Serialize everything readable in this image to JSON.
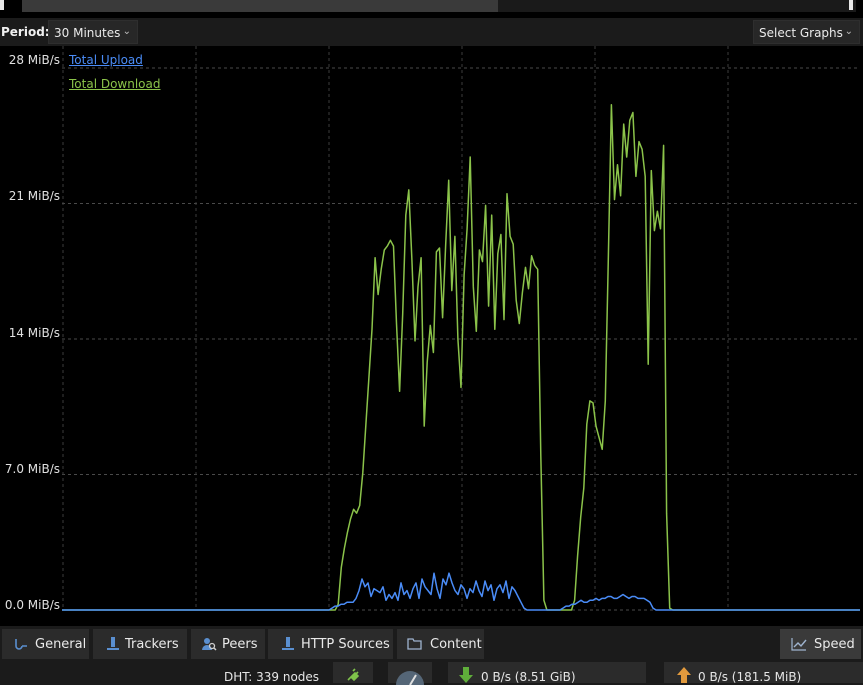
{
  "period": {
    "label": "Period:",
    "value": "30 Minutes"
  },
  "graphs_button": {
    "label": "Select Graphs"
  },
  "y_axis": {
    "ticks": [
      "28 MiB/s",
      "21 MiB/s",
      "14 MiB/s",
      "7.0 MiB/s",
      "0.0 MiB/s"
    ]
  },
  "legend": {
    "upload": {
      "label": "Total Upload",
      "color": "#4a8cf7"
    },
    "download": {
      "label": "Total Download",
      "color": "#8bc34a"
    }
  },
  "chart_data": {
    "type": "line",
    "ylim": [
      0,
      28
    ],
    "grid": true,
    "legend_placement": "top-left",
    "series": [
      {
        "name": "Total Download",
        "color": "#8bc34a",
        "values": [
          0,
          0,
          0,
          0,
          0,
          0,
          0,
          0,
          0,
          0,
          0,
          0,
          0,
          0,
          0,
          0,
          0,
          0,
          0,
          0,
          0,
          0,
          0,
          0,
          0,
          0,
          0,
          0,
          0,
          0,
          0,
          0,
          0,
          0,
          0,
          0,
          0,
          0,
          0,
          0,
          0,
          0,
          0,
          0,
          0,
          0,
          0,
          0,
          0,
          0,
          0,
          0,
          0,
          0,
          0,
          0,
          0,
          0,
          0,
          0,
          0,
          0,
          0,
          0,
          0,
          0,
          0,
          0,
          0,
          0,
          0,
          0,
          0,
          0,
          0,
          0,
          0,
          0,
          0,
          0,
          0,
          0,
          0,
          0,
          0,
          0,
          0,
          0,
          0,
          0,
          0.3,
          2.2,
          3.2,
          4.0,
          4.7,
          5.2,
          5.0,
          5.4,
          7.1,
          9.6,
          12.0,
          14.5,
          18.2,
          16.3,
          17.6,
          18.6,
          18.8,
          19.1,
          18.8,
          14.8,
          11.3,
          15.3,
          20.4,
          21.7,
          18.1,
          13.9,
          16.7,
          18.2,
          9.5,
          12.8,
          14.7,
          13.3,
          18.5,
          18.7,
          15.1,
          18.9,
          22.2,
          16.5,
          19.3,
          14.0,
          11.5,
          17.3,
          19.7,
          23.4,
          16.7,
          14.4,
          18.6,
          18.0,
          20.9,
          15.7,
          20.4,
          14.5,
          18.4,
          19.4,
          15.0,
          21.5,
          19.3,
          18.9,
          16.0,
          14.8,
          16.4,
          17.7,
          16.6,
          18.3,
          17.8,
          17.6,
          8.0,
          0.5,
          0,
          0,
          0,
          0,
          0,
          0,
          0,
          0,
          0,
          0.5,
          2.8,
          4.8,
          6.3,
          9.6,
          10.8,
          10.7,
          9.5,
          8.9,
          8.3,
          10.8,
          18.1,
          26.1,
          21.2,
          23.0,
          21.4,
          25.1,
          23.4,
          25.3,
          25.7,
          22.4,
          24.2,
          23.8,
          22.4,
          12.7,
          22.7,
          19.6,
          20.6,
          19.7,
          24.0,
          5.0,
          0.1,
          0,
          0,
          0,
          0,
          0,
          0,
          0,
          0,
          0,
          0,
          0,
          0,
          0,
          0,
          0,
          0,
          0,
          0,
          0,
          0,
          0,
          0,
          0,
          0,
          0,
          0,
          0,
          0,
          0,
          0,
          0,
          0,
          0,
          0,
          0,
          0,
          0,
          0,
          0,
          0,
          0,
          0,
          0,
          0,
          0,
          0,
          0,
          0,
          0,
          0,
          0,
          0,
          0,
          0,
          0,
          0,
          0,
          0,
          0,
          0,
          0,
          0
        ]
      },
      {
        "name": "Total Upload",
        "color": "#4a8cf7",
        "values": [
          0,
          0,
          0,
          0,
          0,
          0,
          0,
          0,
          0,
          0,
          0,
          0,
          0,
          0,
          0,
          0,
          0,
          0,
          0,
          0,
          0,
          0,
          0,
          0,
          0,
          0,
          0,
          0,
          0,
          0,
          0,
          0,
          0,
          0,
          0,
          0,
          0,
          0,
          0,
          0,
          0,
          0,
          0,
          0,
          0,
          0,
          0,
          0,
          0,
          0,
          0,
          0,
          0,
          0,
          0,
          0,
          0,
          0,
          0,
          0,
          0,
          0,
          0,
          0,
          0,
          0,
          0,
          0,
          0,
          0,
          0,
          0,
          0,
          0,
          0,
          0,
          0,
          0,
          0,
          0,
          0,
          0,
          0,
          0,
          0,
          0,
          0,
          0,
          0,
          0,
          0.1,
          0.2,
          0.2,
          0.3,
          0.3,
          0.4,
          0.4,
          0.4,
          0.6,
          1.0,
          1.6,
          1.2,
          1.4,
          0.7,
          1.1,
          1.0,
          0.9,
          1.2,
          0.5,
          0.8,
          0.6,
          0.9,
          0.5,
          1.4,
          0.8,
          1.0,
          0.6,
          1.1,
          1.4,
          0.6,
          1.6,
          1.2,
          1.0,
          0.8,
          1.9,
          1.1,
          0.6,
          1.6,
          1.3,
          1.9,
          1.4,
          1.0,
          0.8,
          1.3,
          1.1,
          0.6,
          1.1,
          0.9,
          1.5,
          1.0,
          0.7,
          1.5,
          1.0,
          1.3,
          0.5,
          1.1,
          1.3,
          0.9,
          1.5,
          0.6,
          1.2,
          1.0,
          0.7,
          0.4,
          0.1,
          0,
          0,
          0,
          0,
          0,
          0,
          0,
          0,
          0,
          0,
          0,
          0,
          0.1,
          0.2,
          0.2,
          0.3,
          0.3,
          0.4,
          0.5,
          0.4,
          0.4,
          0.5,
          0.5,
          0.6,
          0.5,
          0.6,
          0.6,
          0.7,
          0.7,
          0.6,
          0.6,
          0.7,
          0.8,
          0.7,
          0.6,
          0.7,
          0.7,
          0.6,
          0.6,
          0.6,
          0.5,
          0.4,
          0.1,
          0,
          0,
          0,
          0,
          0,
          0,
          0,
          0,
          0,
          0,
          0,
          0,
          0,
          0,
          0,
          0,
          0,
          0,
          0,
          0,
          0,
          0,
          0,
          0,
          0,
          0,
          0,
          0,
          0,
          0,
          0,
          0,
          0,
          0,
          0,
          0,
          0,
          0,
          0,
          0,
          0,
          0,
          0,
          0,
          0,
          0,
          0,
          0,
          0,
          0,
          0,
          0,
          0,
          0,
          0,
          0,
          0,
          0,
          0,
          0,
          0,
          0,
          0,
          0,
          0,
          0,
          0,
          0,
          0
        ]
      }
    ]
  },
  "tabs": [
    {
      "label": "General",
      "icon": "general-icon"
    },
    {
      "label": "Trackers",
      "icon": "trackers-icon"
    },
    {
      "label": "Peers",
      "icon": "peers-icon"
    },
    {
      "label": "HTTP Sources",
      "icon": "http-sources-icon"
    },
    {
      "label": "Content",
      "icon": "folder-icon"
    },
    {
      "label": "Speed",
      "icon": "speed-chart-icon",
      "active": true
    }
  ],
  "status": {
    "dht": "DHT: 339 nodes",
    "download": "0 B/s (8.51 GiB)",
    "upload": "0 B/s (181.5 MiB)"
  }
}
